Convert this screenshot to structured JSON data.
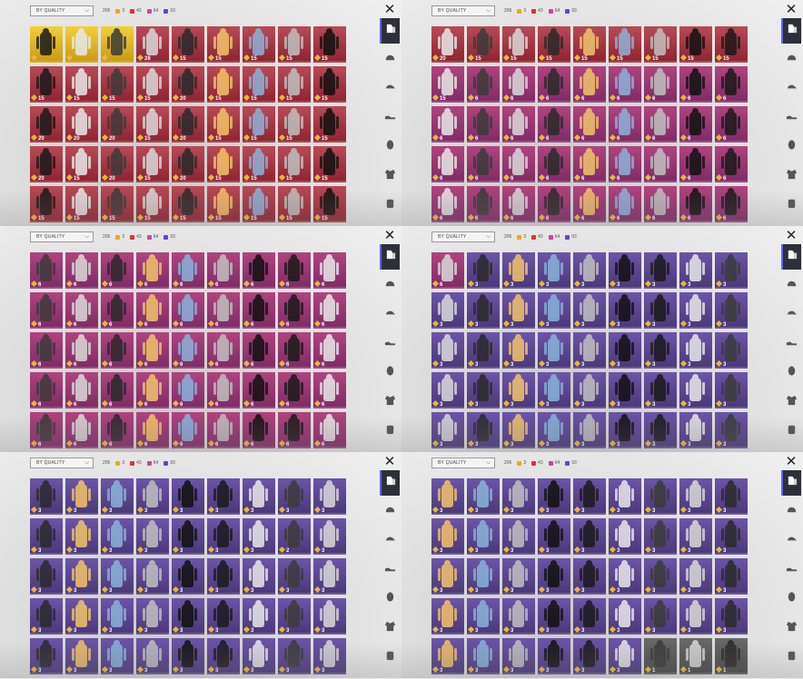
{
  "sort": {
    "label": "BY QUALITY"
  },
  "counts": {
    "total": "206",
    "gold": "3",
    "red": "43",
    "pink": "64",
    "purple": "93"
  },
  "colors": {
    "gold": "#e9a91a",
    "red": "#e0332b",
    "pink": "#d43fa8",
    "purple": "#6a3fd6"
  },
  "sidebar_icons": [
    "outfit-icon",
    "helmet-icon",
    "cap-icon",
    "shoe-icon",
    "mask-icon",
    "jacket-icon",
    "backpack-icon"
  ],
  "panels": [
    {
      "rows": [
        [
          "gold",
          "gold",
          "gold",
          "red",
          "red",
          "red",
          "red",
          "red",
          "red"
        ],
        [
          "red",
          "red",
          "red",
          "red",
          "red",
          "red",
          "red",
          "red",
          "red"
        ],
        [
          "red",
          "red",
          "red",
          "red",
          "red",
          "red",
          "red",
          "red",
          "red"
        ],
        [
          "red",
          "red",
          "red",
          "red",
          "red",
          "red",
          "red",
          "red",
          "red"
        ],
        [
          "red",
          "red",
          "red",
          "red",
          "red",
          "red",
          "red",
          "red",
          "red"
        ]
      ],
      "qty": [
        [
          "",
          "",
          "",
          "28",
          "15",
          "15",
          "15",
          "15",
          "15"
        ],
        [
          "15",
          "15",
          "15",
          "15",
          "20",
          "15",
          "15",
          "15",
          "15"
        ],
        [
          "20",
          "20",
          "20",
          "15",
          "20",
          "15",
          "15",
          "15",
          "15"
        ],
        [
          "20",
          "15",
          "20",
          "15",
          "20",
          "15",
          "15",
          "15",
          "15"
        ],
        [
          "15",
          "15",
          "15",
          "15",
          "15",
          "15",
          "15",
          "15",
          "15"
        ]
      ]
    },
    {
      "rows": [
        [
          "red",
          "red",
          "red",
          "red",
          "red",
          "red",
          "red",
          "red",
          "red"
        ],
        [
          "pink",
          "pink",
          "pink",
          "pink",
          "pink",
          "pink",
          "pink",
          "pink",
          "pink"
        ],
        [
          "pink",
          "pink",
          "pink",
          "pink",
          "pink",
          "pink",
          "pink",
          "pink",
          "pink"
        ],
        [
          "pink",
          "pink",
          "pink",
          "pink",
          "pink",
          "pink",
          "pink",
          "pink",
          "pink"
        ],
        [
          "pink",
          "pink",
          "pink",
          "pink",
          "pink",
          "pink",
          "pink",
          "pink",
          "pink"
        ]
      ],
      "qty": [
        [
          "20",
          "15",
          "15",
          "15",
          "15",
          "15",
          "15",
          "15",
          "15"
        ],
        [
          "15",
          "6",
          "6",
          "6",
          "6",
          "6",
          "6",
          "6",
          "6"
        ],
        [
          "6",
          "6",
          "6",
          "6",
          "6",
          "6",
          "6",
          "6",
          "6"
        ],
        [
          "6",
          "6",
          "6",
          "6",
          "6",
          "6",
          "6",
          "6",
          "6"
        ],
        [
          "6",
          "6",
          "6",
          "6",
          "6",
          "6",
          "6",
          "6",
          "6"
        ]
      ]
    },
    {
      "rows": [
        [
          "pink",
          "pink",
          "pink",
          "pink",
          "pink",
          "pink",
          "pink",
          "pink",
          "pink"
        ],
        [
          "pink",
          "pink",
          "pink",
          "pink",
          "pink",
          "pink",
          "pink",
          "pink",
          "pink"
        ],
        [
          "pink",
          "pink",
          "pink",
          "pink",
          "pink",
          "pink",
          "pink",
          "pink",
          "pink"
        ],
        [
          "pink",
          "pink",
          "pink",
          "pink",
          "pink",
          "pink",
          "pink",
          "pink",
          "pink"
        ],
        [
          "pink",
          "pink",
          "pink",
          "pink",
          "pink",
          "pink",
          "pink",
          "pink",
          "pink"
        ]
      ],
      "qty": [
        [
          "6",
          "6",
          "6",
          "6",
          "6",
          "6",
          "6",
          "6",
          "6"
        ],
        [
          "6",
          "6",
          "6",
          "6",
          "6",
          "6",
          "6",
          "6",
          "6"
        ],
        [
          "6",
          "6",
          "6",
          "6",
          "6",
          "6",
          "6",
          "6",
          "6"
        ],
        [
          "6",
          "6",
          "6",
          "6",
          "6",
          "6",
          "6",
          "6",
          "6"
        ],
        [
          "6",
          "6",
          "6",
          "6",
          "6",
          "6",
          "6",
          "6",
          "6"
        ]
      ]
    },
    {
      "rows": [
        [
          "pink",
          "purple",
          "purple",
          "purple",
          "purple",
          "purple",
          "purple",
          "purple",
          "purple"
        ],
        [
          "purple",
          "purple",
          "purple",
          "purple",
          "purple",
          "purple",
          "purple",
          "purple",
          "purple"
        ],
        [
          "purple",
          "purple",
          "purple",
          "purple",
          "purple",
          "purple",
          "purple",
          "purple",
          "purple"
        ],
        [
          "purple",
          "purple",
          "purple",
          "purple",
          "purple",
          "purple",
          "purple",
          "purple",
          "purple"
        ],
        [
          "purple",
          "purple",
          "purple",
          "purple",
          "purple",
          "purple",
          "purple",
          "purple",
          "purple"
        ]
      ],
      "qty": [
        [
          "6",
          "3",
          "3",
          "3",
          "3",
          "3",
          "3",
          "3",
          "3"
        ],
        [
          "3",
          "3",
          "3",
          "3",
          "3",
          "3",
          "3",
          "3",
          "3"
        ],
        [
          "3",
          "3",
          "3",
          "3",
          "3",
          "3",
          "3",
          "3",
          "3"
        ],
        [
          "3",
          "3",
          "3",
          "3",
          "3",
          "3",
          "3",
          "3",
          "3"
        ],
        [
          "3",
          "3",
          "3",
          "3",
          "3",
          "3",
          "3",
          "3",
          "3"
        ]
      ]
    },
    {
      "rows": [
        [
          "purple",
          "purple",
          "purple",
          "purple",
          "purple",
          "purple",
          "purple",
          "purple",
          "purple"
        ],
        [
          "purple",
          "purple",
          "purple",
          "purple",
          "purple",
          "purple",
          "purple",
          "purple",
          "purple"
        ],
        [
          "purple",
          "purple",
          "purple",
          "purple",
          "purple",
          "purple",
          "purple",
          "purple",
          "purple"
        ],
        [
          "purple",
          "purple",
          "purple",
          "purple",
          "purple",
          "purple",
          "purple",
          "purple",
          "purple"
        ],
        [
          "purple",
          "purple",
          "purple",
          "purple",
          "purple",
          "purple",
          "purple",
          "purple",
          "purple"
        ]
      ],
      "qty": [
        [
          "3",
          "3",
          "3",
          "3",
          "3",
          "3",
          "3",
          "3",
          "3"
        ],
        [
          "3",
          "3",
          "3",
          "3",
          "3",
          "3",
          "3",
          "2",
          "3"
        ],
        [
          "3",
          "3",
          "3",
          "3",
          "3",
          "3",
          "3",
          "3",
          "3"
        ],
        [
          "3",
          "3",
          "3",
          "3",
          "3",
          "3",
          "3",
          "3",
          "3"
        ],
        [
          "3",
          "3",
          "3",
          "3",
          "3",
          "3",
          "3",
          "3",
          "3"
        ]
      ]
    },
    {
      "rows": [
        [
          "purple",
          "purple",
          "purple",
          "purple",
          "purple",
          "purple",
          "purple",
          "purple",
          "purple"
        ],
        [
          "purple",
          "purple",
          "purple",
          "purple",
          "purple",
          "purple",
          "purple",
          "purple",
          "purple"
        ],
        [
          "purple",
          "purple",
          "purple",
          "purple",
          "purple",
          "purple",
          "purple",
          "purple",
          "purple"
        ],
        [
          "purple",
          "purple",
          "purple",
          "purple",
          "purple",
          "purple",
          "purple",
          "purple",
          "purple"
        ],
        [
          "purple",
          "purple",
          "purple",
          "purple",
          "purple",
          "purple",
          "grey",
          "grey",
          "grey"
        ]
      ],
      "qty": [
        [
          "3",
          "3",
          "3",
          "3",
          "3",
          "3",
          "3",
          "3",
          "3"
        ],
        [
          "3",
          "3",
          "3",
          "3",
          "3",
          "3",
          "3",
          "3",
          "3"
        ],
        [
          "3",
          "3",
          "3",
          "3",
          "3",
          "3",
          "3",
          "3",
          "3"
        ],
        [
          "3",
          "3",
          "3",
          "3",
          "3",
          "3",
          "3",
          "3",
          "3"
        ],
        [
          "3",
          "3",
          "3",
          "3",
          "3",
          "3",
          "1",
          "1",
          "1"
        ]
      ]
    }
  ]
}
